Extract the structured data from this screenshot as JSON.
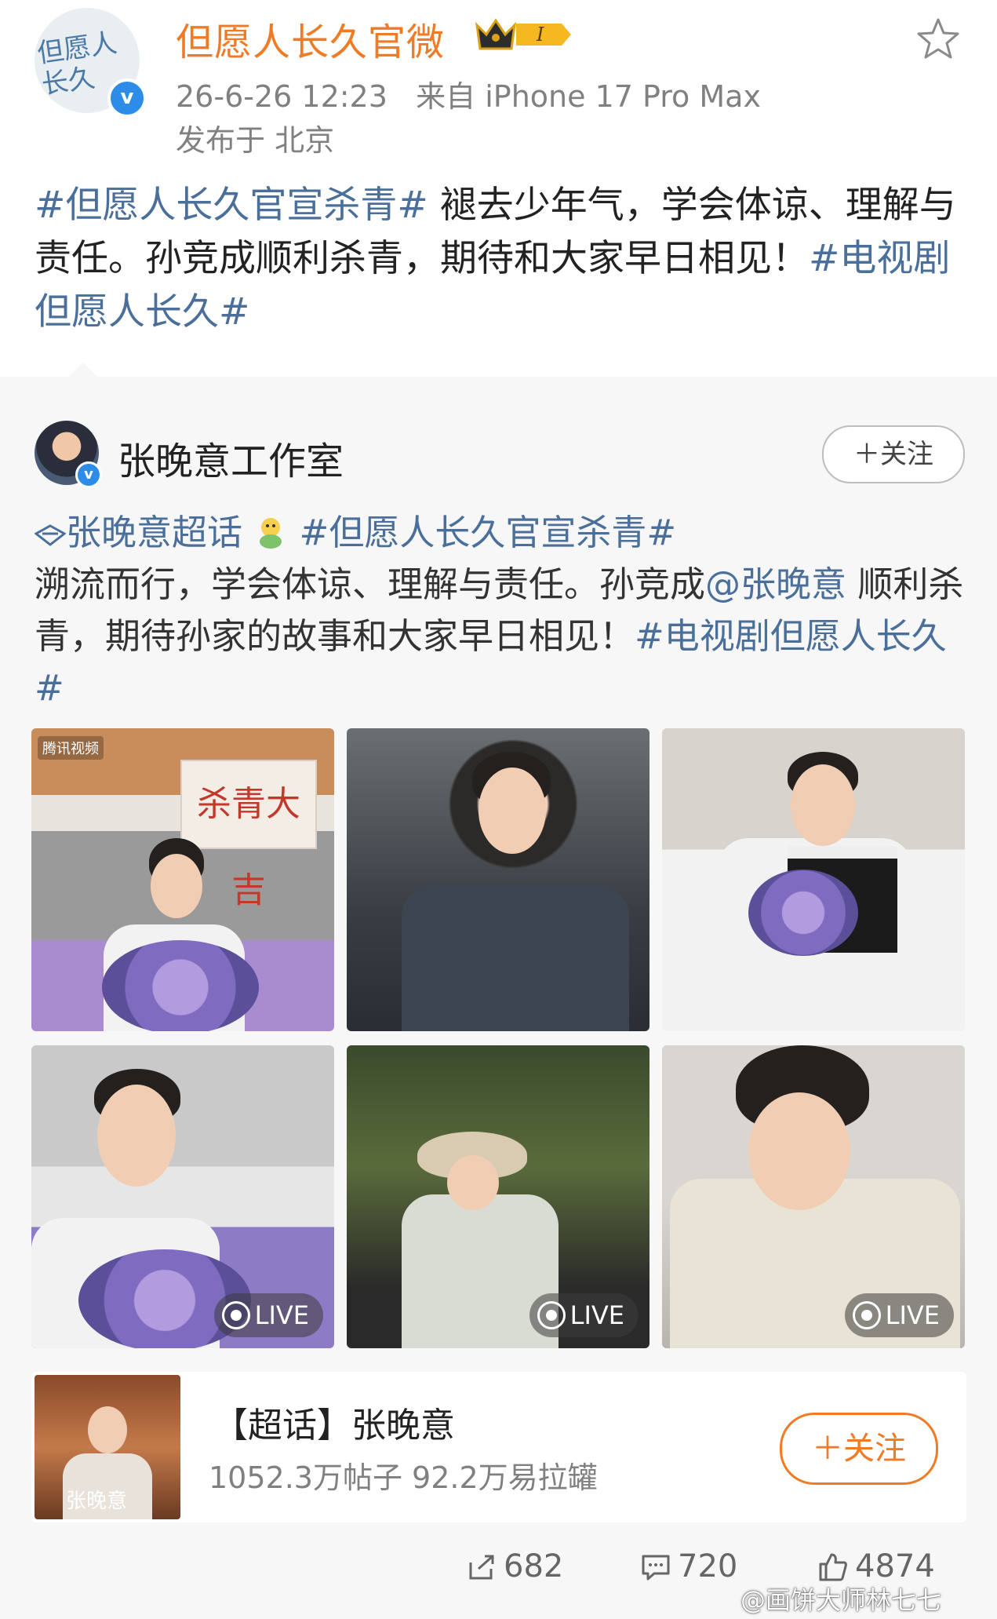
{
  "post": {
    "author": "但愿人长久官微",
    "avatar_text": "但愿人长久",
    "badge_level": "I",
    "timestamp": "26-6-26 12:23",
    "source": "来自 iPhone 17 Pro Max",
    "location": "发布于 北京",
    "text_tag1": "#但愿人长久官宣杀青#",
    "text_body": " 褪去少年气，学会体谅、理解与责任。孙竞成顺利杀青，期待和大家早日相见！",
    "text_tag2": "#电视剧但愿人长久#"
  },
  "repost": {
    "author": "张晚意工作室",
    "follow_label": "＋关注",
    "super_topic_link": "张晚意超话",
    "tag1": "#但愿人长久官宣杀青#",
    "body_part1": "溯流而行，学会体谅、理解与责任。孙竞成",
    "mention": "@张晚意",
    "body_part2": " 顺利杀青，期待孙家的故事和大家早日相见！",
    "tag2": "#电视剧但愿人长久#",
    "images": [
      {
        "overlay": "腾讯视频",
        "card_text": "杀青大吉"
      },
      {
        "overlay": ""
      },
      {
        "overlay": ""
      },
      {
        "live": "LIVE"
      },
      {
        "live": "LIVE"
      },
      {
        "live": "LIVE"
      }
    ]
  },
  "supertopic": {
    "title": "【超话】张晚意",
    "stats": "1052.3万帖子 92.2万易拉罐",
    "follow_label": "＋关注",
    "thumb_name": "张晚意"
  },
  "actions": {
    "reposts": "682",
    "comments": "720",
    "likes": "4874"
  },
  "watermark": "@画饼大师林七七",
  "colors": {
    "brand_orange": "#f07b24",
    "link_blue": "#4a6f9a",
    "verified_blue": "#2d8ce8"
  }
}
